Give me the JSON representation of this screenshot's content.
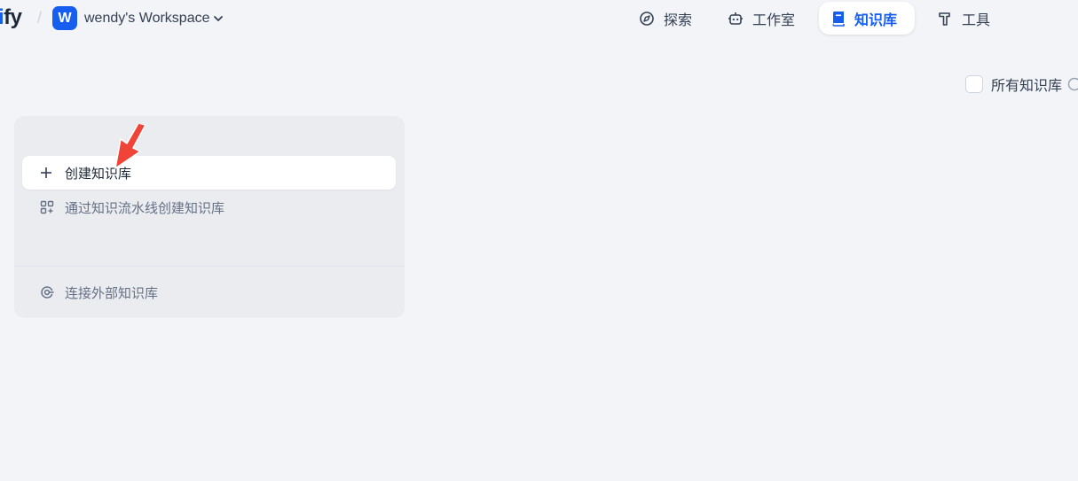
{
  "header": {
    "logo_prefix": "i",
    "logo_suffix": "fy",
    "workspace": {
      "avatar_letter": "W",
      "name": "wendy's Workspace"
    },
    "nav": [
      {
        "label": "探索",
        "icon": "compass-icon",
        "active": false
      },
      {
        "label": "工作室",
        "icon": "robot-icon",
        "active": false
      },
      {
        "label": "知识库",
        "icon": "book-icon",
        "active": true
      },
      {
        "label": "工具",
        "icon": "hammer-icon",
        "active": false
      }
    ]
  },
  "filter": {
    "label": "所有知识库",
    "checked": false
  },
  "create_card": {
    "create_label": "创建知识库",
    "pipeline_label": "通过知识流水线创建知识库",
    "external_label": "连接外部知识库"
  },
  "colors": {
    "accent": "#155eef",
    "background": "#f2f4f7",
    "card": "#eaecf0",
    "arrow": "#f04438"
  }
}
